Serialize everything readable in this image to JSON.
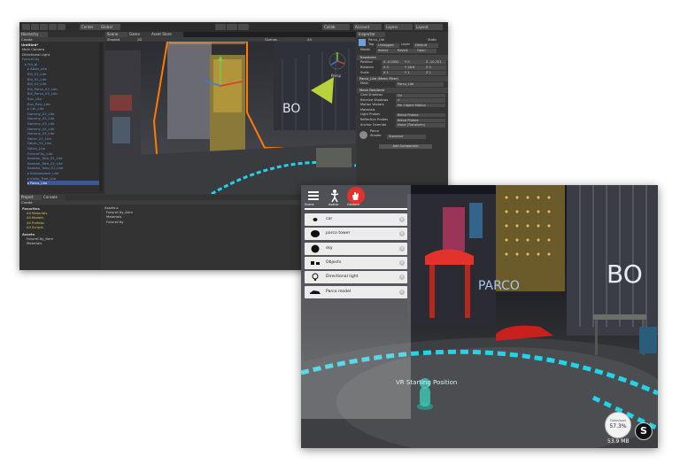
{
  "editor": {
    "toolbar": {
      "pivot": "Center",
      "space": "Global",
      "play_icon": "play-icon",
      "pause_icon": "pause-icon",
      "step_icon": "step-icon",
      "collab": "Collab",
      "account": "Account",
      "layers": "Layers",
      "layout": "Layout"
    },
    "hierarchy": {
      "tab": "Hierarchy",
      "create": "Create",
      "scene": "Untitled*",
      "items": [
        {
          "label": "Main Camera",
          "indent": 1,
          "style": "normal"
        },
        {
          "label": "Directional Light",
          "indent": 1,
          "style": "normal"
        },
        {
          "label": "FutureCity",
          "indent": 1,
          "style": "blue"
        },
        {
          "label": "▸ Fut_bl",
          "indent": 2,
          "style": "blue"
        },
        {
          "label": "▸ Abstr_Lite",
          "indent": 3,
          "style": "blue"
        },
        {
          "label": "Bill_01_Lite",
          "indent": 3,
          "style": "blue"
        },
        {
          "label": "Bill_02_Lite",
          "indent": 3,
          "style": "blue"
        },
        {
          "label": "Bill_03_Lite",
          "indent": 3,
          "style": "blue"
        },
        {
          "label": "Bill_Parco_02_Lite",
          "indent": 3,
          "style": "blue"
        },
        {
          "label": "Bill_Parco_03_Lite",
          "indent": 3,
          "style": "blue"
        },
        {
          "label": "Bus_Lite",
          "indent": 3,
          "style": "blue"
        },
        {
          "label": "Bus_Pole_Lite",
          "indent": 3,
          "style": "blue"
        },
        {
          "label": "▸ Car_Lite",
          "indent": 3,
          "style": "blue"
        },
        {
          "label": "Dammy_01_Lite",
          "indent": 3,
          "style": "blue"
        },
        {
          "label": "Dammy_02_Lite",
          "indent": 3,
          "style": "blue"
        },
        {
          "label": "Dammy_03_Lite",
          "indent": 3,
          "style": "blue"
        },
        {
          "label": "Dammy_04_Lite",
          "indent": 3,
          "style": "blue"
        },
        {
          "label": "Dammy_05_Lite",
          "indent": 3,
          "style": "blue"
        },
        {
          "label": "Fabric_01_Lite",
          "indent": 3,
          "style": "blue"
        },
        {
          "label": "Fabric_02_Lite",
          "indent": 3,
          "style": "blue"
        },
        {
          "label": "Fabric_Lite",
          "indent": 3,
          "style": "blue"
        },
        {
          "label": "FutureCity_Lite",
          "indent": 3,
          "style": "blue"
        },
        {
          "label": "Kanban_Tate_01_Lite",
          "indent": 3,
          "style": "blue"
        },
        {
          "label": "Kanban_Tate_02_Lite",
          "indent": 3,
          "style": "blue"
        },
        {
          "label": "Kanban_Yoko_01_Lite",
          "indent": 3,
          "style": "blue"
        },
        {
          "label": "▸ Kanbanpack_Lite",
          "indent": 3,
          "style": "blue"
        },
        {
          "label": "▸ Kinko_Tree_Lite",
          "indent": 3,
          "style": "blue"
        },
        {
          "label": "▸ Parco_Lite",
          "indent": 3,
          "style": "selected"
        }
      ]
    },
    "scene_view": {
      "tab_scene": "Scene",
      "tab_game": "Game",
      "tab_asset_store": "Asset Store",
      "shading": "Shaded",
      "mode_2d": "2D",
      "gizmos": "Gizmos",
      "search": "All",
      "persp": "Persp"
    },
    "inspector": {
      "tab": "Inspector",
      "object_name": "Parco_Lite",
      "static": "Static",
      "tag_label": "Tag",
      "tag_value": "Untagged",
      "layer_label": "Layer",
      "layer_value": "Default",
      "prefab_model": "Model",
      "prefab_select": "Select",
      "prefab_revert": "Revert",
      "prefab_open": "Open",
      "transform": {
        "header": "Transform",
        "position": [
          "Position",
          "X -0.0502",
          "Y 0",
          "Z -10.701"
        ],
        "rotation": [
          "Rotation",
          "X 0",
          "Y 28.6",
          "Z 0"
        ],
        "scale": [
          "Scale",
          "X 1",
          "Y 1",
          "Z 1"
        ]
      },
      "mesh_filter": {
        "header": "Parco_Lite (Mesh Filter)",
        "mesh_label": "Mesh",
        "mesh_value": "Parco_Lite"
      },
      "mesh_renderer": {
        "header": "Mesh Renderer",
        "rows": [
          [
            "Cast Shadows",
            "On"
          ],
          [
            "Receive Shadows",
            "✔"
          ],
          [
            "Motion Vectors",
            "Per Object Motion"
          ],
          [
            "Materials",
            ""
          ],
          [
            "Light Probes",
            "Blend Probes"
          ],
          [
            "Reflection Probes",
            "Blend Probes"
          ],
          [
            "Anchor Override",
            "None (Transform)"
          ]
        ]
      },
      "material": {
        "name": "Parco",
        "shader_label": "Shader",
        "shader_value": "Standard"
      },
      "add_component": "Add Component"
    },
    "project": {
      "tab_project": "Project",
      "tab_console": "Console",
      "create": "Create",
      "favorites": "Favorites",
      "fav_items": [
        "All Materials",
        "All Models",
        "All Prefabs",
        "All Scripts"
      ],
      "assets": "Assets",
      "asset_items": [
        "FutureCity_Item",
        "Materials"
      ],
      "breadcrumb": "Assets ▸",
      "folder_items": [
        "FutureCity_Item",
        "Materials",
        "FutureCity"
      ]
    },
    "colors": {
      "bg": "#383838",
      "panel": "#2f2f2f",
      "selection": "#3a5b8c",
      "highlight": "#ff7a00"
    }
  },
  "viewer": {
    "top_icons": [
      {
        "name": "hamburger-menu-icon",
        "label": "Scene"
      },
      {
        "name": "walking-person-icon",
        "label": "Avatar"
      },
      {
        "name": "hand-icon",
        "label": "Gesture"
      }
    ],
    "menu_items": [
      {
        "label": "car",
        "thumb": "car-thumbnail-icon"
      },
      {
        "label": "parco tower",
        "thumb": "tower-thumbnail-icon"
      },
      {
        "label": "sky",
        "thumb": "sky-sphere-icon"
      },
      {
        "label": "Objects",
        "thumb": "objects-icon"
      },
      {
        "label": "Directional light",
        "thumb": "light-bulb-icon"
      },
      {
        "label": "Parco model",
        "thumb": "model-thumbnail-icon"
      }
    ],
    "start_label": "VR Starting Position",
    "sign_parco": "PARCO",
    "badge_label": "Download",
    "badge_percent": "57.3%",
    "size_label": "53.9 MB",
    "brand_icon": "s-logo-icon",
    "colors": {
      "cyan": "#21d4e8",
      "red": "#e2322b",
      "green": "#9ccc3a"
    }
  }
}
